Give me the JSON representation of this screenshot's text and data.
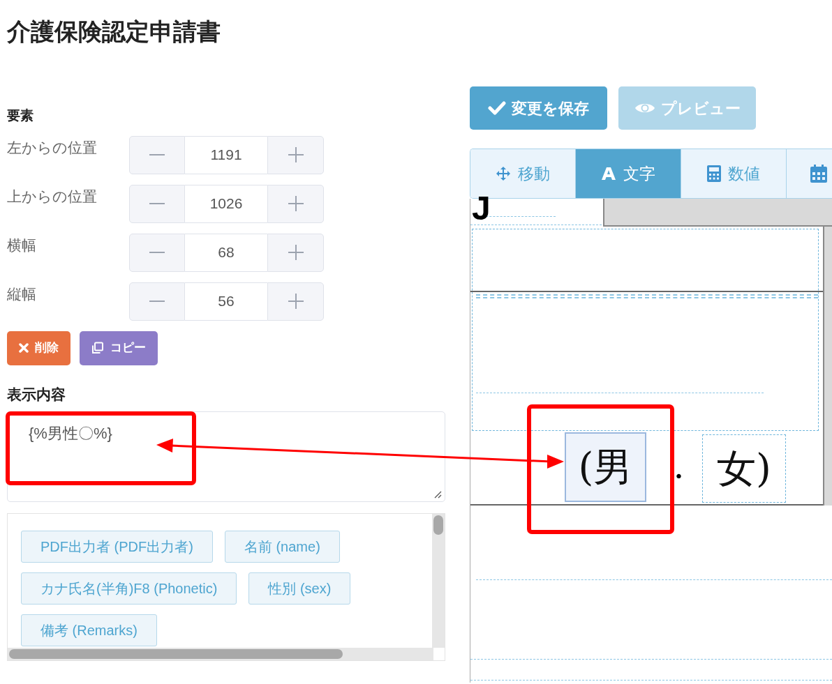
{
  "title": "介護保険認定申請書",
  "element_panel": {
    "heading": "要素",
    "fields": [
      {
        "label": "左からの位置",
        "value": "1191"
      },
      {
        "label": "上からの位置",
        "value": "1026"
      },
      {
        "label": "横幅",
        "value": "68"
      },
      {
        "label": "縦幅",
        "value": "56"
      }
    ],
    "actions": [
      {
        "kind": "delete",
        "label": "削除"
      },
      {
        "kind": "copy",
        "label": "コピー"
      }
    ]
  },
  "content": {
    "heading": "表示内容",
    "value": "{%男性〇%}"
  },
  "variables": [
    "PDF出力者 (PDF出力者)",
    "名前 (name)",
    "カナ氏名(半角)F8 (Phonetic)",
    "性別 (sex)",
    "備考 (Remarks)"
  ],
  "toolbar": [
    {
      "kind": "save",
      "label": "変更を保存",
      "disabled": false
    },
    {
      "kind": "preview",
      "label": "プレビュー",
      "disabled": true
    }
  ],
  "tabs": [
    {
      "kind": "move",
      "label": "移動",
      "selected": false
    },
    {
      "kind": "text",
      "label": "文字",
      "selected": true
    },
    {
      "kind": "number",
      "label": "数値",
      "selected": false
    },
    {
      "kind": "date",
      "selected": false
    }
  ],
  "canvas": {
    "items": [
      {
        "kind": "fragment",
        "text": "J"
      },
      {
        "kind": "option",
        "text": "(男",
        "selected": true
      },
      {
        "kind": "separator",
        "text": "・"
      },
      {
        "kind": "option",
        "text": "女)",
        "selected": false
      }
    ]
  }
}
